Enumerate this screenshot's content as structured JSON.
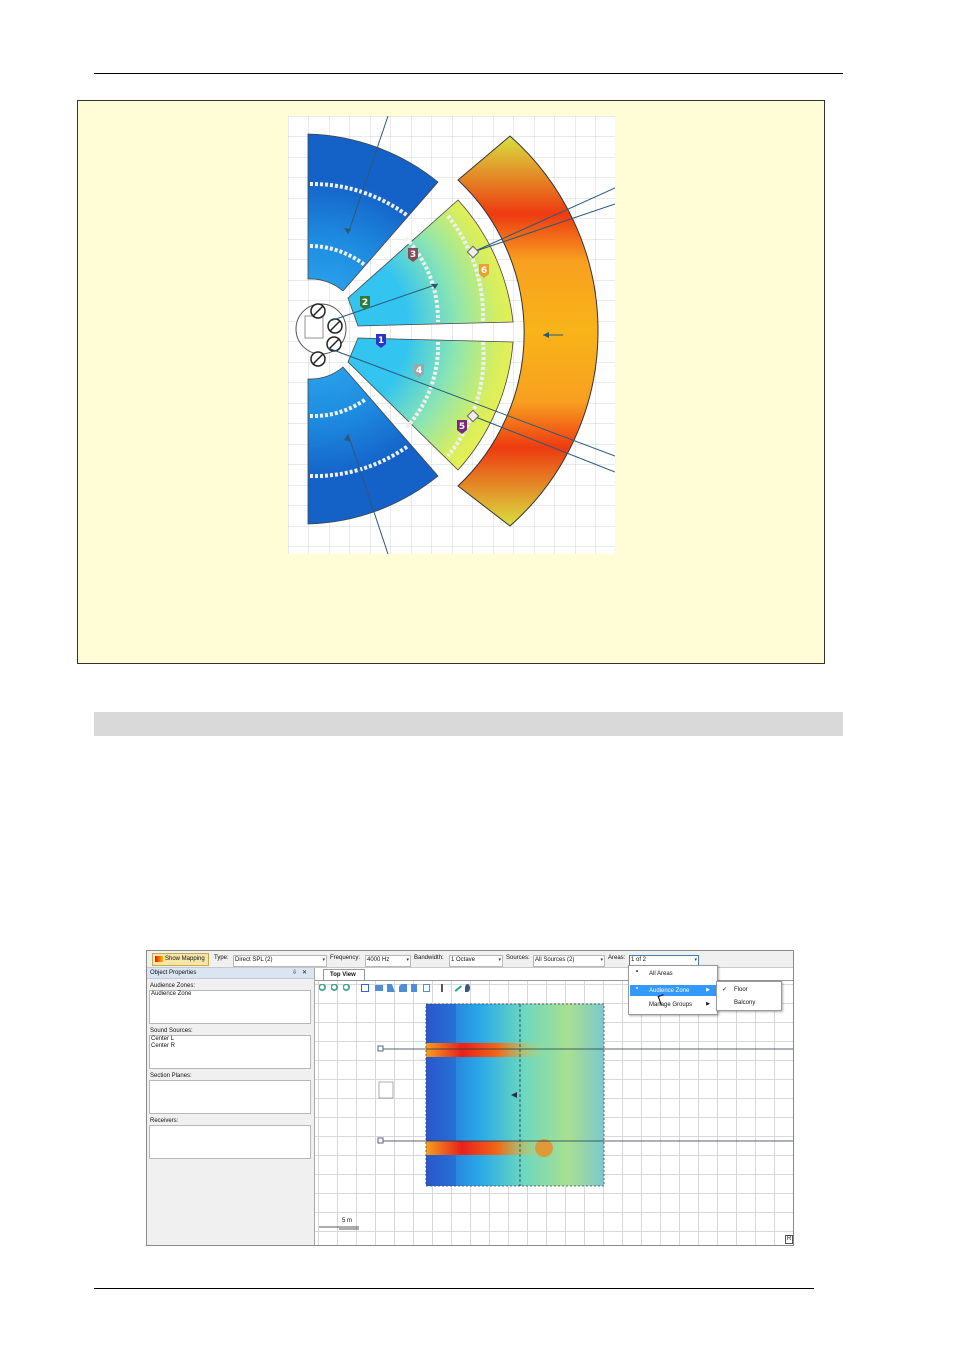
{
  "colors": {
    "note_bg": "#fffdd6",
    "heading_bar": "#d9d9d9",
    "highlight": "#3399ff"
  },
  "figure1": {
    "markers": [
      "1",
      "2",
      "3",
      "4",
      "5",
      "6"
    ],
    "marker_colors": [
      "#2a35c8",
      "#2f7a3a",
      "#8a4a5a",
      "#9aa",
      "#7b2a7b",
      "#e8a030"
    ]
  },
  "app": {
    "show_mapping": "Show Mapping",
    "type_label": "Type:",
    "type_value": "Direct SPL (2)",
    "frequency_label": "Frequency:",
    "frequency_value": "4000 Hz",
    "bandwidth_label": "Bandwidth:",
    "bandwidth_value": "1 Octave",
    "sources_label": "Sources:",
    "sources_value": "All Sources (2)",
    "areas_label": "Areas:",
    "areas_value": "1 of 2",
    "panel_title": "Object Properties",
    "panel_pin": "⇩",
    "panel_close": "✕",
    "audience_zones_label": "Audience Zones:",
    "audience_zones_items": [
      "Audience Zone"
    ],
    "sound_sources_label": "Sound Sources:",
    "sound_sources_items": [
      "Center L",
      "Center R"
    ],
    "section_planes_label": "Section Planes:",
    "receivers_label": "Receivers:",
    "tab_label": "Top View",
    "scale_label": "5 m",
    "corner_label": "R",
    "menu": {
      "all_areas": "All Areas",
      "audience_zone": "Audience Zone",
      "manage_groups": "Manage Groups",
      "arrow": "▶"
    },
    "submenu": {
      "floor": "Floor",
      "balcony": "Balcony",
      "check": "✓"
    }
  }
}
